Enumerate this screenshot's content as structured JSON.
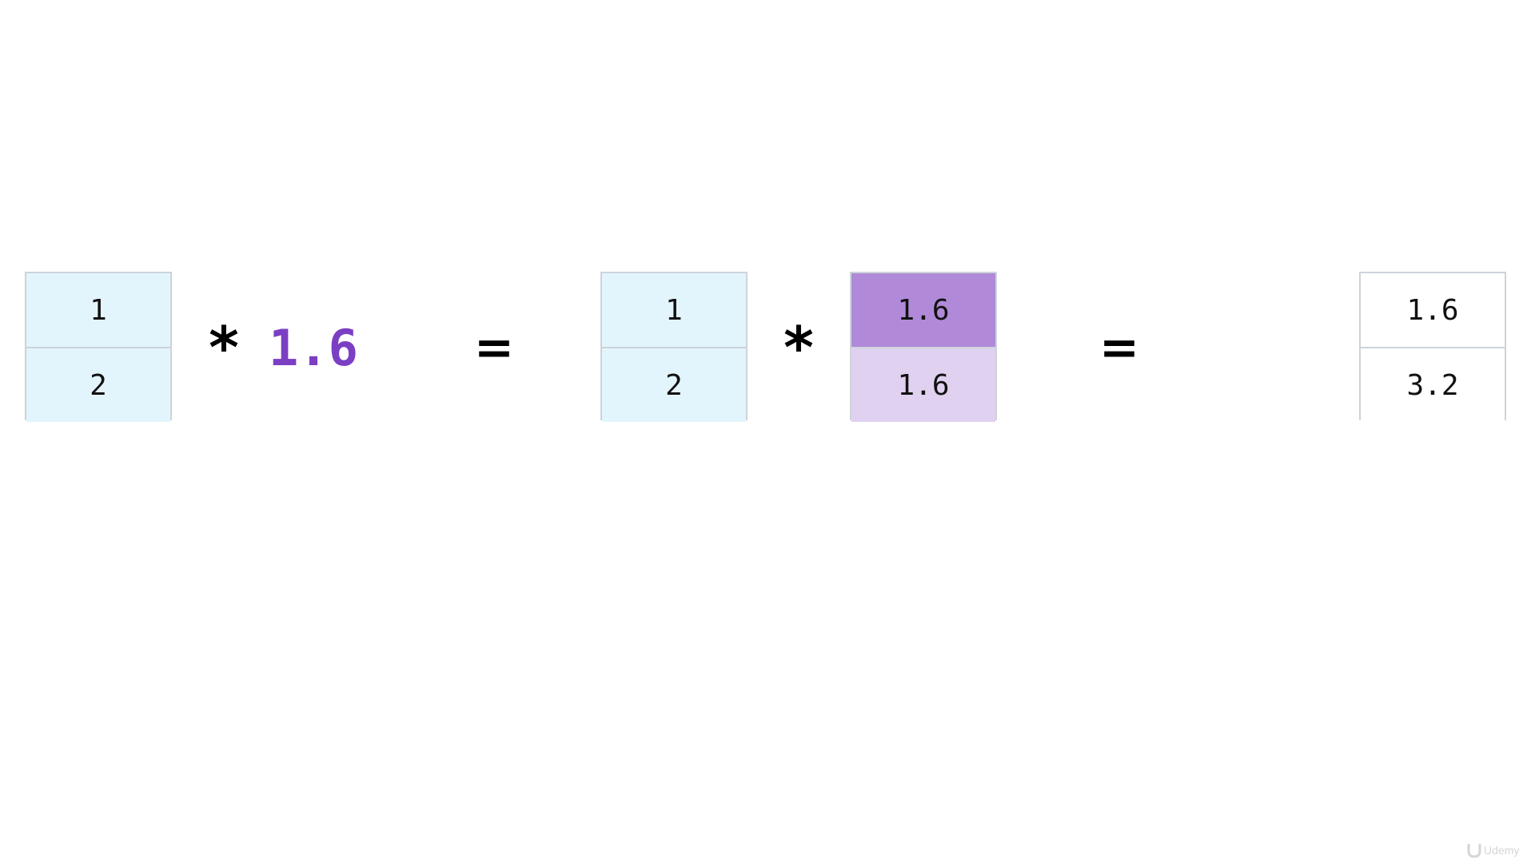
{
  "left_vector": [
    "1",
    "2"
  ],
  "operator_multiply": "*",
  "scalar": "1.6",
  "operator_equals": "=",
  "middle_vector": [
    "1",
    "2"
  ],
  "broadcast_vector": [
    "1.6",
    "1.6"
  ],
  "result_vector": [
    "1.6",
    "3.2"
  ],
  "colors": {
    "input_cell": "#e3f5fc",
    "scalar_text": "#7b3fc4",
    "broadcast_original": "#b08ad9",
    "broadcast_copy": "#e0d1f0",
    "result_cell": "#ffffff",
    "border": "#cdd3da"
  },
  "watermark": "Udemy"
}
